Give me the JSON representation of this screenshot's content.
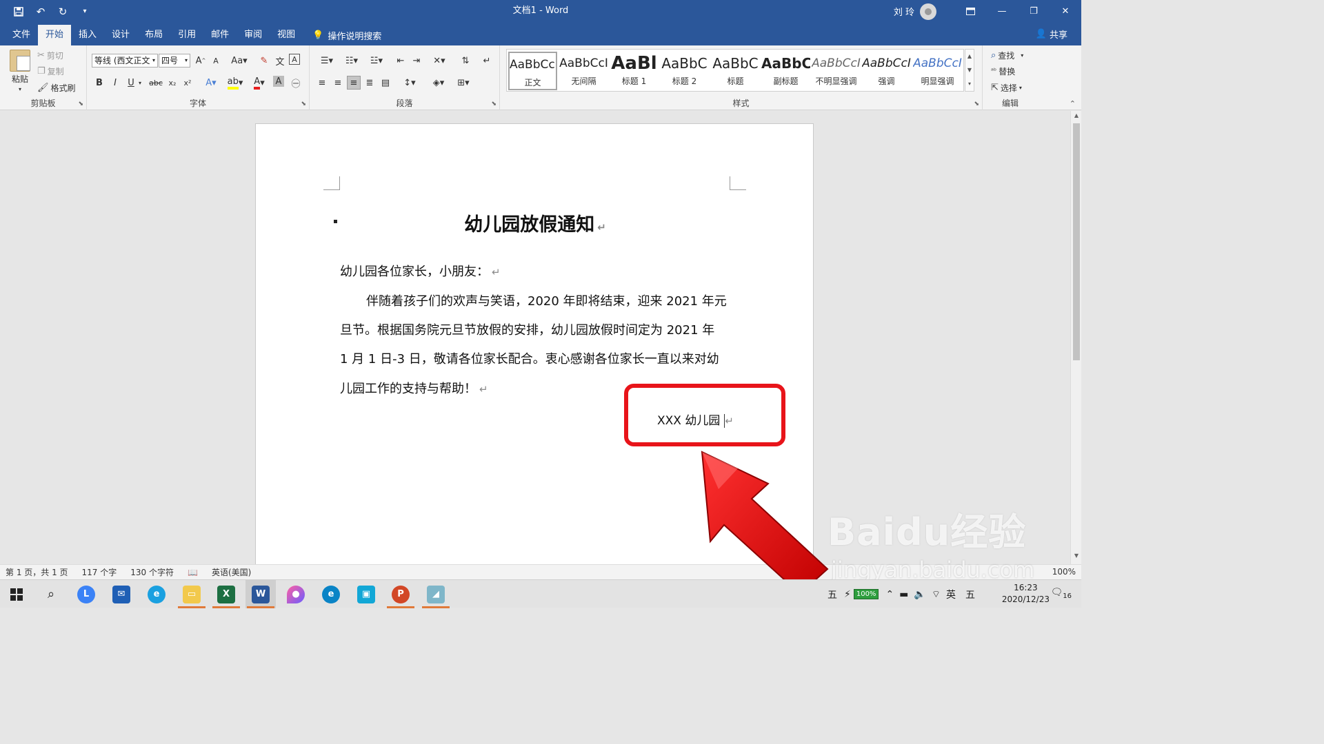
{
  "window": {
    "title": "文档1  -  Word",
    "user": "刘 玲"
  },
  "tabs": [
    "文件",
    "开始",
    "插入",
    "设计",
    "布局",
    "引用",
    "邮件",
    "审阅",
    "视图"
  ],
  "tell_me": "操作说明搜索",
  "share": "共享",
  "ribbon": {
    "clipboard": {
      "label": "剪贴板",
      "paste": "粘贴",
      "cut": "剪切",
      "copy": "复制",
      "painter": "格式刷"
    },
    "font": {
      "label": "字体",
      "font_name": "等线 (西文正文",
      "font_size": "四号"
    },
    "paragraph": {
      "label": "段落"
    },
    "styles": {
      "label": "样式",
      "items": [
        {
          "sample": "AaBbCcI",
          "name": "正文"
        },
        {
          "sample": "AaBbCcI",
          "name": "无间隔"
        },
        {
          "sample": "AaBl",
          "name": "标题 1"
        },
        {
          "sample": "AaBbC",
          "name": "标题 2"
        },
        {
          "sample": "AaBbC",
          "name": "标题"
        },
        {
          "sample": "AaBbC",
          "name": "副标题"
        },
        {
          "sample": "AaBbCcI",
          "name": "不明显强调"
        },
        {
          "sample": "AaBbCcI",
          "name": "强调"
        },
        {
          "sample": "AaBbCcI",
          "name": "明显强调"
        }
      ]
    },
    "editing": {
      "label": "编辑",
      "find": "查找",
      "replace": "替换",
      "select": "选择"
    }
  },
  "document": {
    "title": "幼儿园放假通知",
    "greeting": "幼儿园各位家长，小朋友：",
    "body_lines": [
      "伴随着孩子们的欢声与笑语，2020 年即将结束，迎来 2021 年元",
      "旦节。根据国务院元旦节放假的安排，幼儿园放假时间定为 2021 年",
      "1 月 1 日-3 日，敬请各位家长配合。衷心感谢各位家长一直以来对幼",
      "儿园工作的支持与帮助！"
    ],
    "signature": "XXX 幼儿园",
    "para_mark": "↵"
  },
  "status": {
    "page": "第 1 页，共 1 页",
    "words": "117 个字",
    "chars": "130 个字符",
    "lang": "英语(美国)",
    "zoom": "100%"
  },
  "watermark": {
    "main": "Baidu经验",
    "sub": "jingyan.baidu.com"
  },
  "taskbar": {
    "battery": "100%",
    "ime": "英",
    "ime2": "五",
    "time": "16:23",
    "date": "2020/12/23",
    "notifications": "16"
  }
}
